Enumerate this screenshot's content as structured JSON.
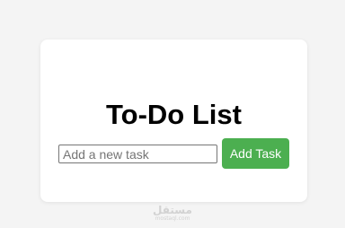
{
  "colors": {
    "page_background": "#f4f4f4",
    "card_background": "#ffffff",
    "button_background": "#4caf50",
    "button_text": "#ffffff"
  },
  "todo": {
    "title": "To-Do List",
    "input": {
      "value": "",
      "placeholder": "Add a new task"
    },
    "add_button_label": "Add Task"
  },
  "watermark": {
    "arabic": "مستقل",
    "latin": "mostaql.com"
  }
}
